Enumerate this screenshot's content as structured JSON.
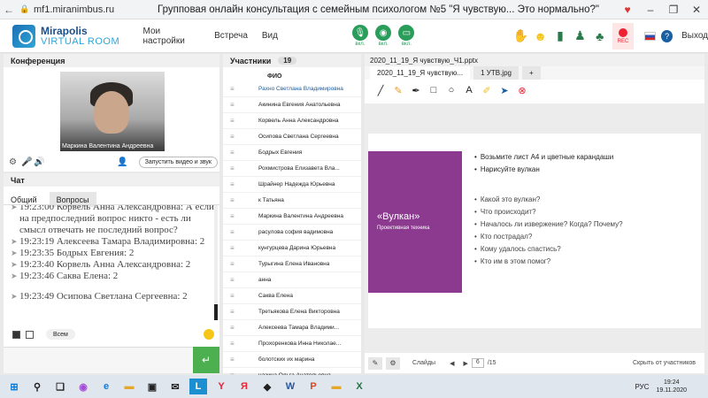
{
  "browser": {
    "url": "mf1.miranimbus.ru",
    "title": "Групповая онлайн консультация с семейным психологом №5 \"Я чувствую... Это нормально?\""
  },
  "header": {
    "logo_line1": "Mirapolis",
    "logo_line2": "VIRTUAL ROOM",
    "menu": [
      "Мои настройки",
      "Встреча",
      "Вид"
    ],
    "mic_label": "вкл.",
    "cam_label": "вкл.",
    "screen_label": "вкл.",
    "rec_label": "REC",
    "help": "?",
    "exit": "Выход"
  },
  "conference": {
    "title": "Конференция",
    "video_name": "Маркина Валентина Андреевна",
    "video_select": "Запустить видео и звук"
  },
  "chat": {
    "title": "Чат",
    "tabs": [
      "Общий",
      "Вопросы"
    ],
    "messages": [
      {
        "text": "19:23:00 Корвель Анна Александровна: А если на предпоследний вопрос никто - есть ли смысл отвечать не последний вопрос?"
      },
      {
        "text": "19:23:19 Алексеева Тамара Владимировна: 2"
      },
      {
        "text": "19:23:35 Бодрых Евгения: 2"
      },
      {
        "text": "19:23:40 Корвель Анна Александровна: 2"
      },
      {
        "text": "19:23:46 Саква Елена: 2"
      },
      {
        "text": "19:23:49 Осипова Светлана Сергеевна: 2"
      }
    ],
    "to_select": "Всем"
  },
  "participants": {
    "title": "Участники",
    "count": "19",
    "col": "ФИО",
    "list": [
      "Рахно Светлана Владимировна",
      "Акинина Евгения Анатольевна",
      "Корвель Анна Александровна",
      "Осипова Светлана Сергеевна",
      "Бодрых Евгения",
      "Рохмистрова Елизавета Вла...",
      "Шрайнер Надежда Юрьевна",
      "к Татьяна",
      "Маркина Валентина Андреевна",
      "расулова софия вадимовна",
      "кунгурцева Дарина Юрьевна",
      "Турыгина Елена Ивановна",
      "анна",
      "Саква Елена",
      "Третьякова Елена Викторовна",
      "Алексеева Тамара Владими...",
      "Прохоренкова Инна Николае...",
      "болотских их марина",
      "назина Ольга Анатольевна"
    ]
  },
  "presentation": {
    "file": "2020_11_19_Я чувствую_Ч1.pptx",
    "tabs": [
      "2020_11_19_Я чувствую...",
      "1 УТВ.jpg",
      "+"
    ],
    "slide_title": "«Вулкан»",
    "slide_subtitle": "Проективная техника",
    "bullets_main": [
      "Возьмите лист А4 и цветные карандаши",
      "Нарисуйте вулкан"
    ],
    "bullets_questions": [
      "Какой это вулкан?",
      "Что происходит?",
      "Началось ли извержение? Когда? Почему?",
      "Кто пострадал?",
      "Кому удалось спастись?",
      "Кто им в этом помог?"
    ],
    "status_slides": "Слайды",
    "page": "6",
    "total": "/15",
    "hide_text": "Скрыть от участников"
  },
  "taskbar": {
    "lang": "РУС",
    "time": "19:24",
    "date": "19.11.2020"
  }
}
